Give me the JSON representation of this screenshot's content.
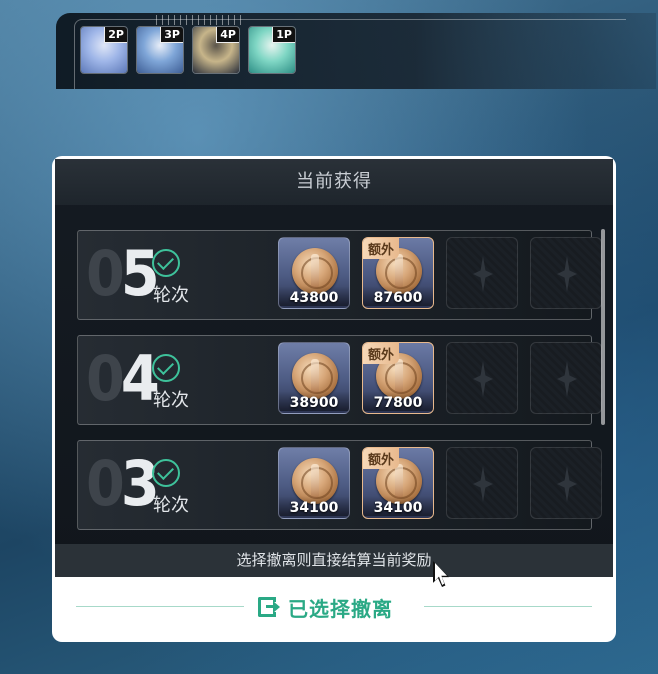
{
  "party": {
    "slots": [
      {
        "badge": "2P",
        "portrait_icon": "character-portrait-silver-hair",
        "colors": [
          "#9fb6e8",
          "#dfe6f7",
          "#5d79b8"
        ]
      },
      {
        "badge": "3P",
        "portrait_icon": "character-portrait-white-hair",
        "colors": [
          "#7fa6d8",
          "#e8eef8",
          "#3f5f96"
        ]
      },
      {
        "badge": "4P",
        "portrait_icon": "character-portrait-dark-hair",
        "colors": [
          "#c7b58a",
          "#5b554b",
          "#2a2f3a"
        ]
      },
      {
        "badge": "1P",
        "portrait_icon": "character-portrait-teal-hair",
        "colors": [
          "#7fd6c4",
          "#e6f4ef",
          "#2e8f86"
        ]
      }
    ]
  },
  "panel": {
    "title": "当前获得",
    "rounds": [
      {
        "number_dim": "0",
        "number": "5",
        "label": "轮次",
        "completed": true,
        "rewards": [
          {
            "value": "43800",
            "extra": false
          },
          {
            "value": "87600",
            "extra": true,
            "tag": "额外"
          }
        ]
      },
      {
        "number_dim": "0",
        "number": "4",
        "label": "轮次",
        "completed": true,
        "rewards": [
          {
            "value": "38900",
            "extra": false
          },
          {
            "value": "77800",
            "extra": true,
            "tag": "额外"
          }
        ]
      },
      {
        "number_dim": "0",
        "number": "3",
        "label": "轮次",
        "completed": true,
        "rewards": [
          {
            "value": "34100",
            "extra": false
          },
          {
            "value": "34100",
            "extra": true,
            "tag": "额外"
          }
        ]
      }
    ],
    "hint": "选择撤离则直接结算当前奖励",
    "withdraw_label": "已选择撤离"
  },
  "colors": {
    "accent": "#2aa985",
    "check": "#3ec29b",
    "extra_tag": "#e8b98d"
  }
}
